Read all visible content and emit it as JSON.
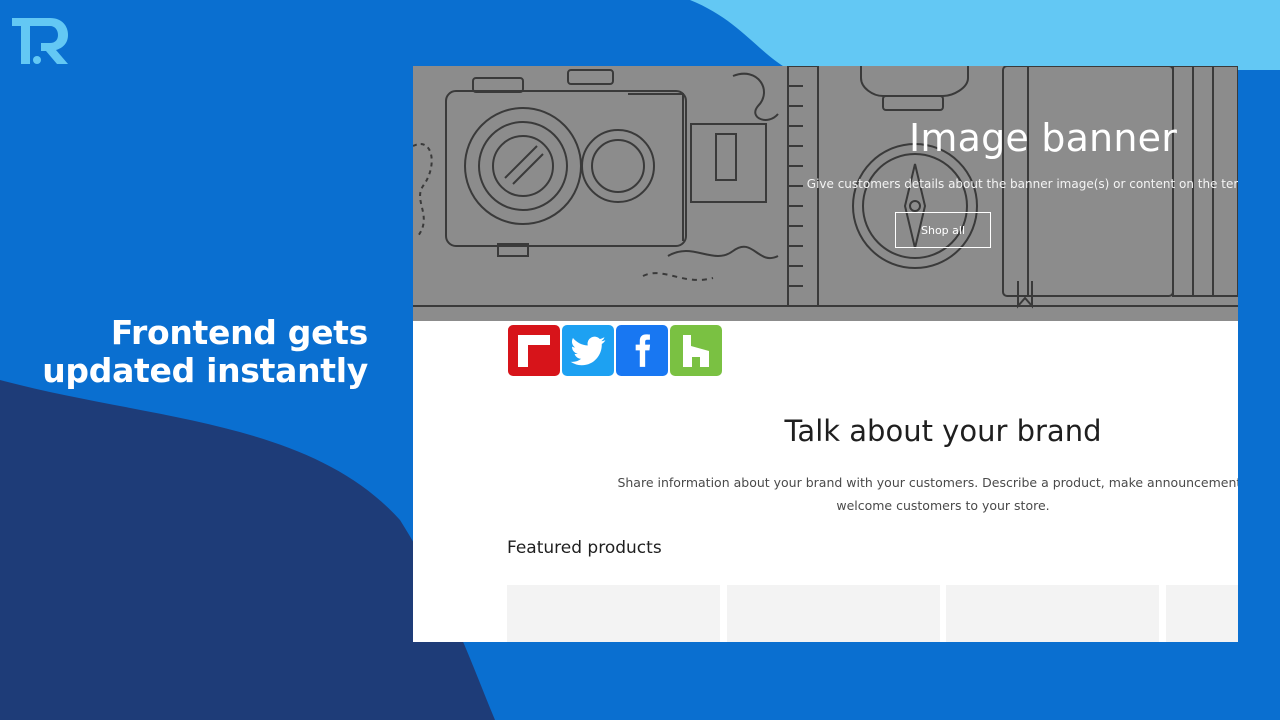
{
  "logo": {
    "name": "tr-logo-icon"
  },
  "tagline": {
    "line1": "Frontend gets",
    "line2": "updated instantly"
  },
  "banner": {
    "title": "Image banner",
    "subtitle": "Give customers details about the banner image(s) or content on the template.",
    "button_label": "Shop all"
  },
  "share_buttons": [
    {
      "name": "flipboard-icon",
      "color": "#d7141a"
    },
    {
      "name": "twitter-icon",
      "color": "#1da1f2"
    },
    {
      "name": "facebook-icon",
      "color": "#1877f2"
    },
    {
      "name": "houzz-icon",
      "color": "#7ac142"
    }
  ],
  "brand": {
    "title": "Talk about your brand",
    "text_line1": "Share information about your brand with your customers. Describe a product, make announcements, or",
    "text_line2": "welcome customers to your store."
  },
  "featured": {
    "heading": "Featured products"
  },
  "colors": {
    "background": "#0a6fd0",
    "light_blue": "#63c8f4",
    "dark_navy": "#1e3c78",
    "banner_gray": "#8c8c8c"
  }
}
